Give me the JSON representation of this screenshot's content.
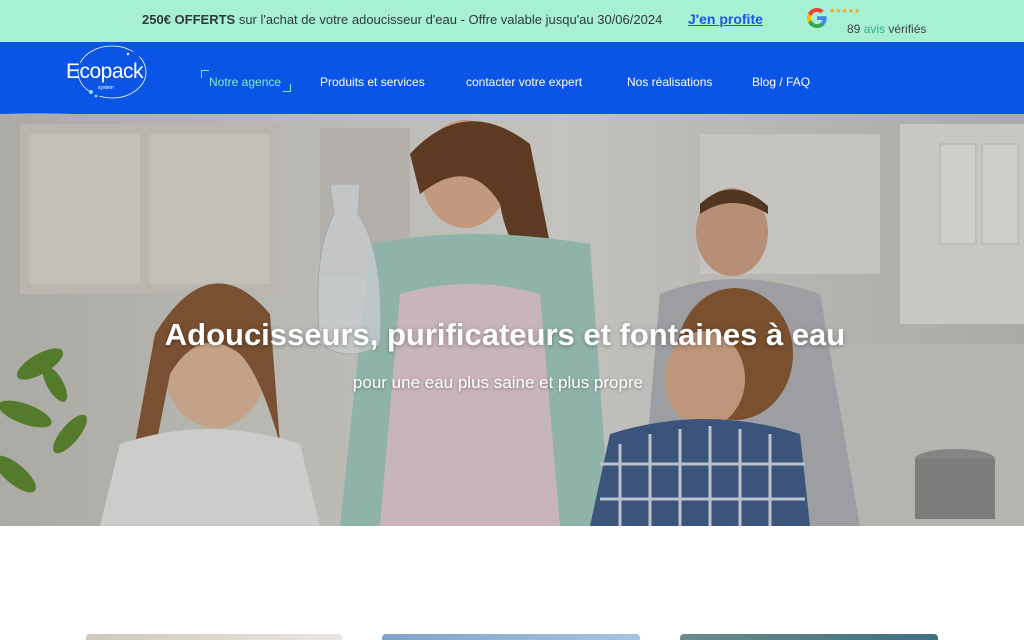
{
  "promo": {
    "highlight": "250€ OFFERTS",
    "text": " sur l'achat de votre adoucisseur d'eau - Offre valable jusqu'au 30/06/2024",
    "cta": "J'en profite",
    "rating_icon": "google-icon",
    "stars": "★★★★★",
    "review_count": "89",
    "review_word": "avis",
    "review_suffix": "vérifiés"
  },
  "brand": {
    "logo_text": "Ecopack",
    "logo_sub": "system"
  },
  "nav": {
    "items": [
      {
        "label": "Notre agence",
        "active": true
      },
      {
        "label": "Produits et services"
      },
      {
        "label": "contacter votre expert"
      },
      {
        "label": "Nos réalisations"
      },
      {
        "label": "Blog / FAQ"
      }
    ]
  },
  "hero": {
    "title": "Adoucisseurs, purificateurs et fontaines à eau",
    "subtitle": "pour une eau plus saine et plus propre"
  },
  "colors": {
    "promo_bg": "#a8f0d4",
    "nav_bg": "#0a55e6",
    "accent": "#7df0c8",
    "link": "#1a56e8"
  }
}
